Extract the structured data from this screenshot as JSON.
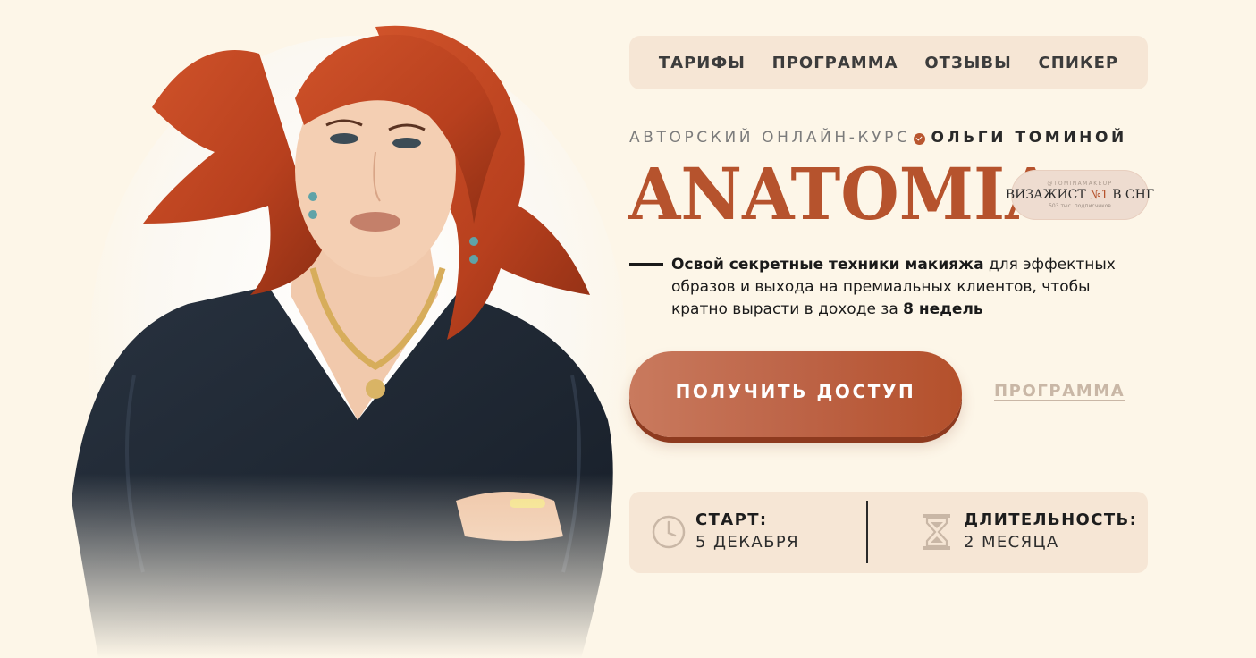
{
  "nav": {
    "items": [
      "ТАРИФЫ",
      "ПРОГРАММА",
      "ОТЗЫВЫ",
      "СПИКЕР"
    ]
  },
  "hero": {
    "subtitle_prefix": "АВТОРСКИЙ ОНЛАЙН-КУРС",
    "subtitle_author": "ОЛЬГИ ТОМИНОЙ",
    "title": "ANATOMIA",
    "badge": {
      "handle": "@TOMINAMAKEUP",
      "main_left": "ВИЗАЖИСТ",
      "main_num": "№1",
      "main_right": "В СНГ",
      "sub": "503 тыс. подписчиков"
    },
    "description": {
      "bold1": "Освой секретные техники макияжа",
      "text1": " для эффектных образов и выхода на премиальных клиентов, чтобы кратно вырасти в доходе за ",
      "bold2": "8 недель"
    },
    "cta_label": "ПОЛУЧИТЬ ДОСТУП",
    "program_link": "ПРОГРАММА"
  },
  "info": {
    "start_label": "СТАРТ:",
    "start_value": "5 ДЕКАБРЯ",
    "duration_label": "ДЛИТЕЛЬНОСТЬ:",
    "duration_value": "2 МЕСЯЦА"
  },
  "icons": {
    "clock": "clock-icon",
    "hourglass": "hourglass-icon",
    "check": "check-badge-icon"
  },
  "colors": {
    "background": "#fdf6e8",
    "panel": "#f6e6d5",
    "accent": "#b6532d",
    "cta_start": "#c97a5e",
    "cta_end": "#b4502b",
    "link_muted": "#c9b7a6"
  }
}
